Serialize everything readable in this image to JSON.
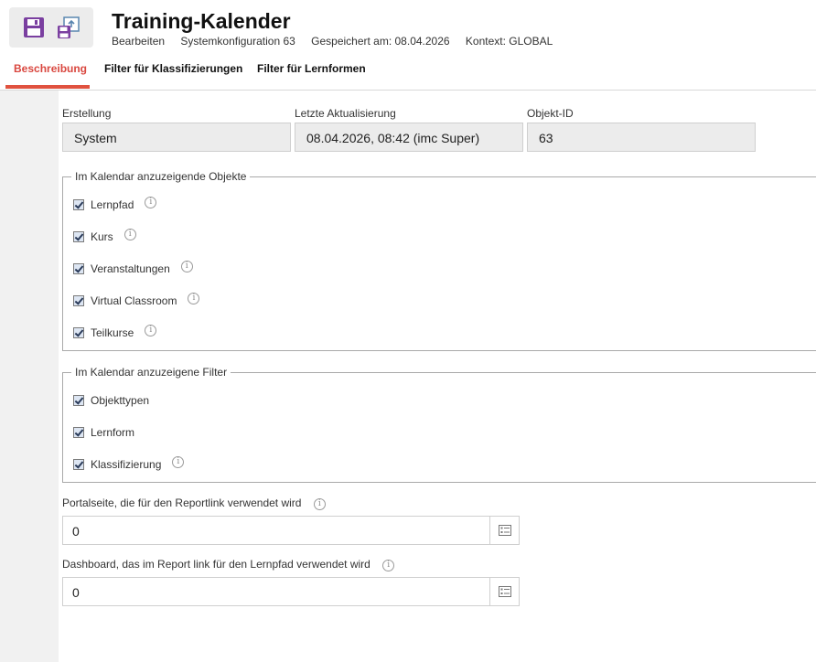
{
  "header": {
    "title": "Training-Kalender",
    "meta": {
      "mode": "Bearbeiten",
      "config": "Systemkonfiguration 63",
      "saved": "Gespeichert am: 08.04.2026",
      "context": "Kontext: GLOBAL"
    },
    "icons": {
      "save": "save-icon",
      "save_as": "save-copy-icon"
    }
  },
  "tabs": [
    {
      "label": "Beschreibung",
      "active": true
    },
    {
      "label": "Filter für Klassifizierungen",
      "active": false
    },
    {
      "label": "Filter für Lernformen",
      "active": false
    }
  ],
  "info_fields": {
    "creation": {
      "label": "Erstellung",
      "value": "System"
    },
    "last_update": {
      "label": "Letzte Aktualisierung",
      "value": "08.04.2026, 08:42 (imc Super)"
    },
    "object_id": {
      "label": "Objekt-ID",
      "value": "63"
    }
  },
  "objects_group": {
    "legend": "Im Kalendar anzuzeigende Objekte",
    "items": [
      {
        "label": "Lernpfad",
        "checked": true,
        "info": true
      },
      {
        "label": "Kurs",
        "checked": true,
        "info": true
      },
      {
        "label": "Veranstaltungen",
        "checked": true,
        "info": true
      },
      {
        "label": "Virtual Classroom",
        "checked": true,
        "info": true
      },
      {
        "label": "Teilkurse",
        "checked": true,
        "info": true
      }
    ]
  },
  "filters_group": {
    "legend": "Im Kalendar anzuzeigene Filter",
    "items": [
      {
        "label": "Objekttypen",
        "checked": true,
        "info": false
      },
      {
        "label": "Lernform",
        "checked": true,
        "info": false
      },
      {
        "label": "Klassifizierung",
        "checked": true,
        "info": true
      }
    ]
  },
  "portal_page": {
    "label": "Portalseite, die für den Reportlink verwendet wird",
    "value": "0"
  },
  "dashboard": {
    "label": "Dashboard, das im Report link für den Lernpfad verwendet wird",
    "value": "0"
  },
  "colors": {
    "accent": "#e0523f",
    "icon_purple": "#7a3fa0",
    "field_bg": "#ececec"
  }
}
